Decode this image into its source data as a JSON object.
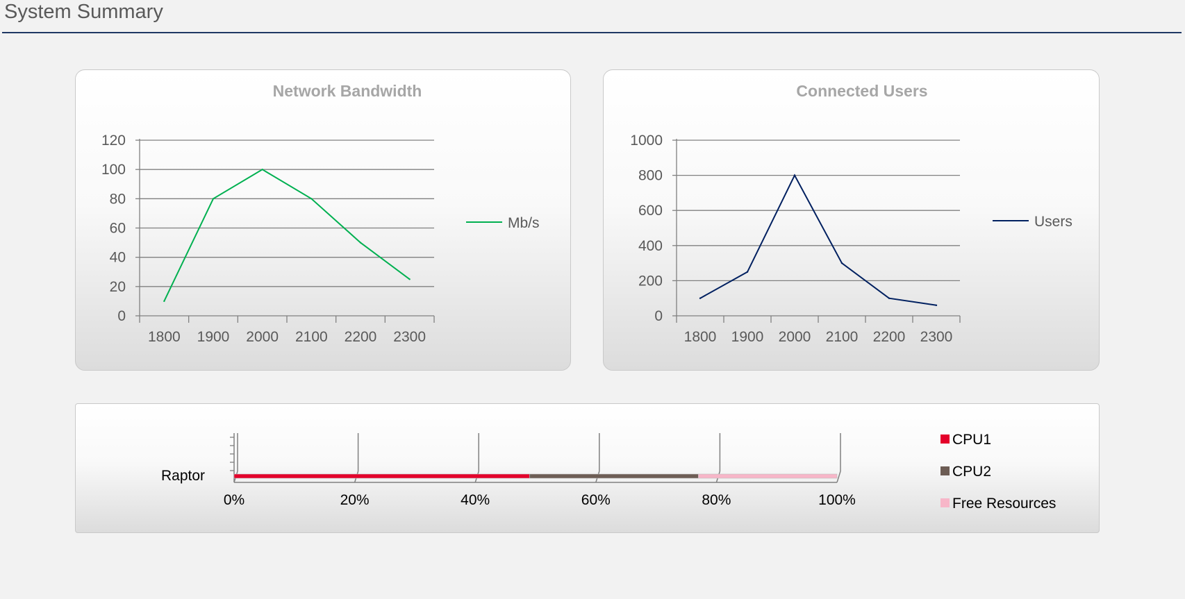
{
  "page": {
    "title": "System Summary"
  },
  "chart_data": [
    {
      "type": "line",
      "title": "Network Bandwidth",
      "categories": [
        "1800",
        "1900",
        "2000",
        "2100",
        "2200",
        "2300"
      ],
      "series": [
        {
          "name": "Mb/s",
          "color": "#00b050",
          "values": [
            10,
            80,
            100,
            80,
            50,
            25
          ]
        }
      ],
      "ylim": [
        0,
        120
      ],
      "yticks": [
        0,
        20,
        40,
        60,
        80,
        100,
        120
      ],
      "grid": true,
      "legend": "right"
    },
    {
      "type": "line",
      "title": "Connected Users",
      "categories": [
        "1800",
        "1900",
        "2000",
        "2100",
        "2200",
        "2300"
      ],
      "series": [
        {
          "name": "Users",
          "color": "#002060",
          "values": [
            100,
            250,
            800,
            300,
            100,
            60
          ]
        }
      ],
      "ylim": [
        0,
        1000
      ],
      "yticks": [
        0,
        200,
        400,
        600,
        800,
        1000
      ],
      "grid": true,
      "legend": "right"
    },
    {
      "type": "bar",
      "stacked": "percent",
      "orientation": "horizontal",
      "categories": [
        "Raptor"
      ],
      "series": [
        {
          "name": "CPU1",
          "color": "#e4002b",
          "values": [
            49
          ]
        },
        {
          "name": "CPU2",
          "color": "#6d5d55",
          "values": [
            28
          ]
        },
        {
          "name": "Free Resources",
          "color": "#f7b6c8",
          "values": [
            23
          ]
        }
      ],
      "xlim": [
        0,
        100
      ],
      "xticks": [
        "0%",
        "20%",
        "40%",
        "60%",
        "80%",
        "100%"
      ],
      "legend": "right"
    }
  ]
}
